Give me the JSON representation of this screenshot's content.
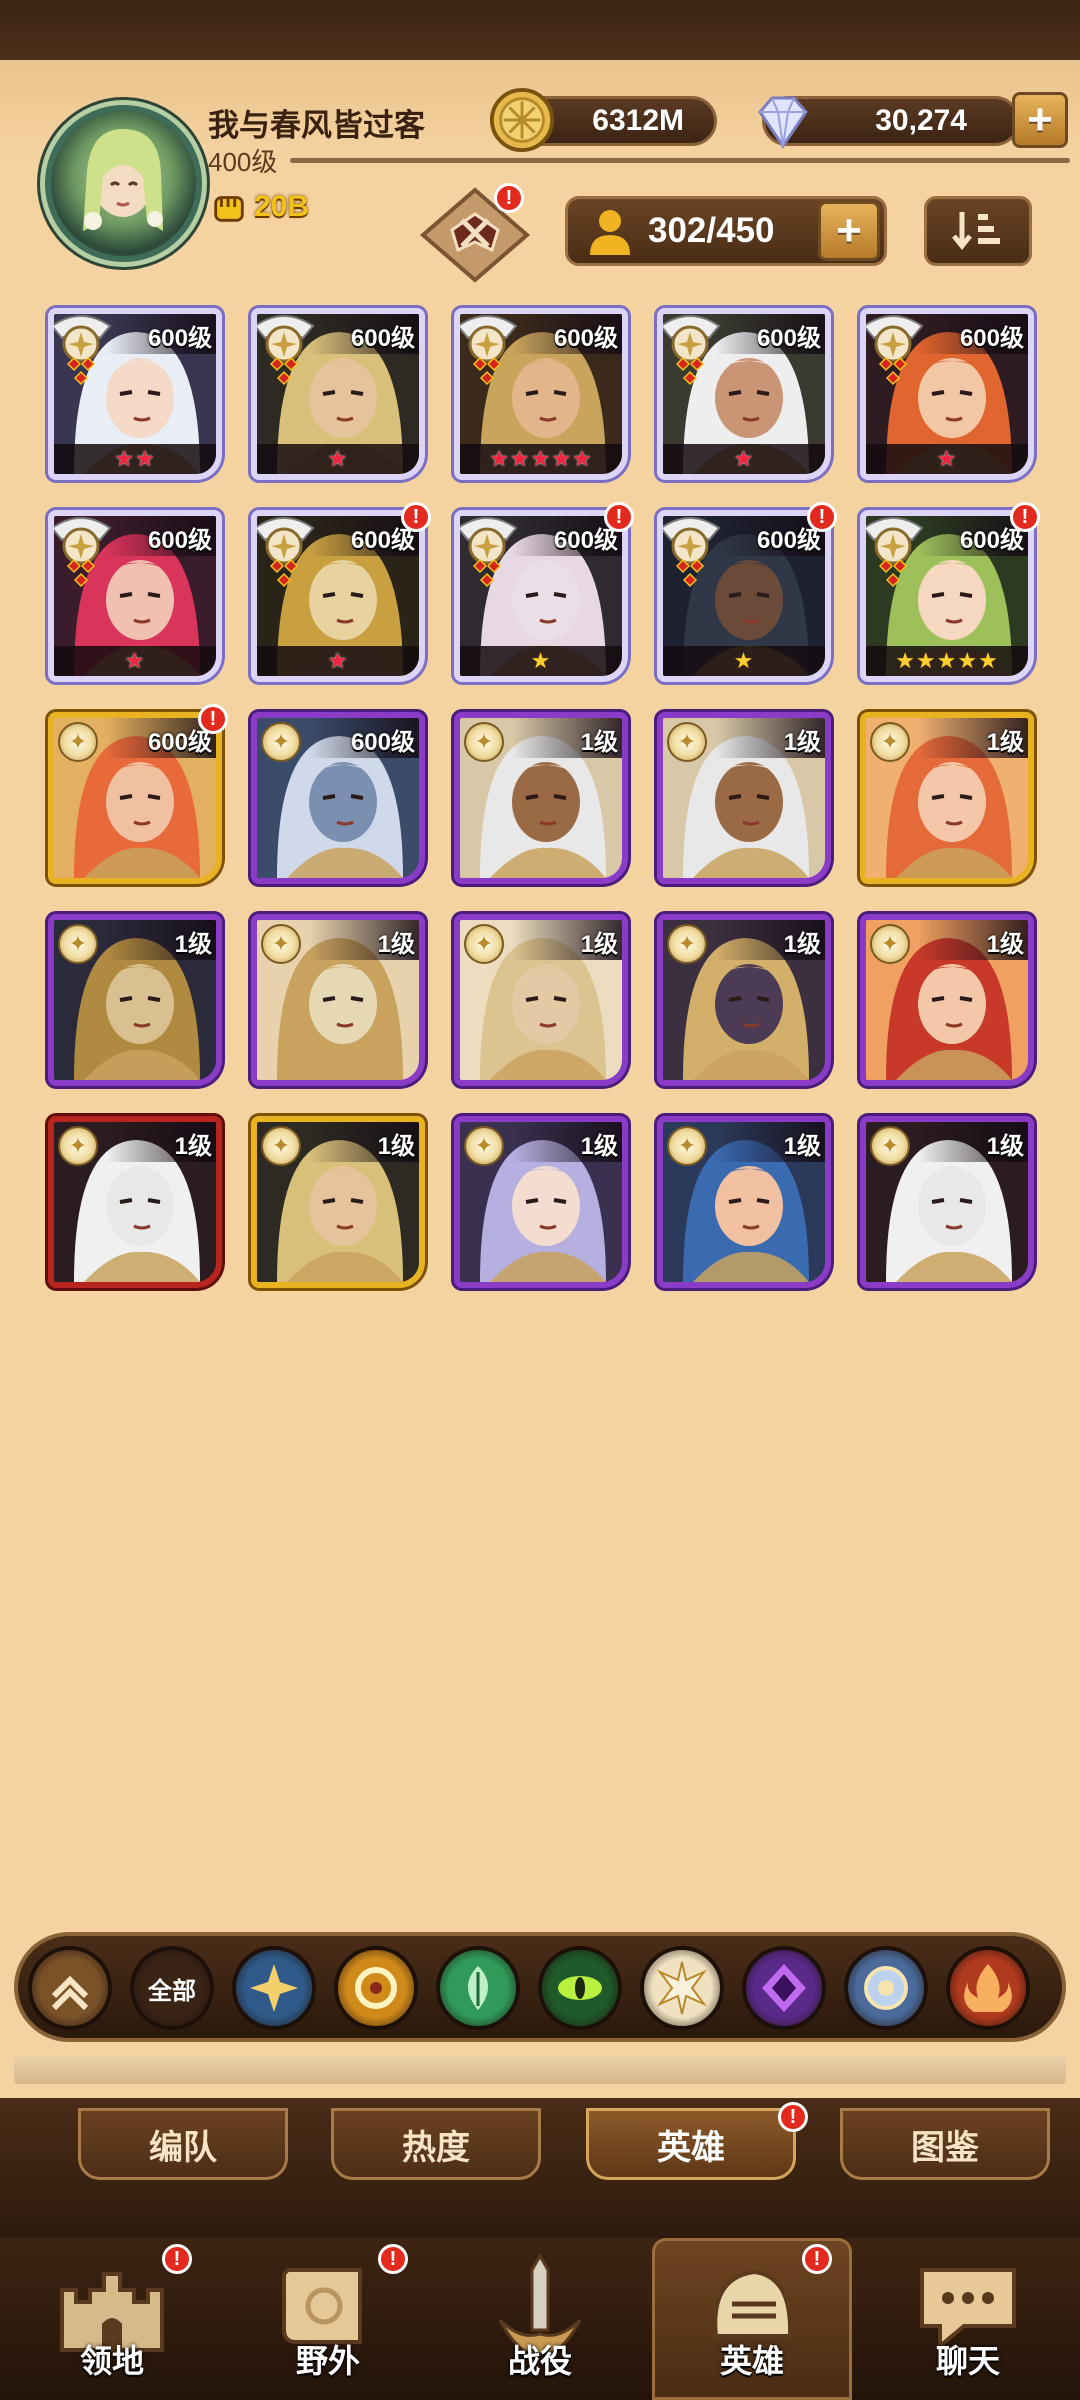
{
  "player": {
    "name": "我与春风皆过客",
    "level": "400级",
    "power": "20B"
  },
  "resources": {
    "gold": "6312M",
    "gems": "30,274",
    "plus": "+"
  },
  "roster": {
    "count": "302/450",
    "plus": "+"
  },
  "badge_mark": "!",
  "heroes": [
    {
      "level": "600级",
      "stars": "★★",
      "star_color": "red",
      "frame": "white",
      "medal": true,
      "skin": "#f3d9c6",
      "hair": "#e9eef6",
      "bg": "#3a3550",
      "alert": false
    },
    {
      "level": "600级",
      "stars": "★",
      "star_color": "red",
      "frame": "white",
      "medal": true,
      "skin": "#e5c39b",
      "hair": "#d9c07a",
      "bg": "#2c2a22",
      "alert": false
    },
    {
      "level": "600级",
      "stars": "★★★★★",
      "star_color": "red",
      "frame": "white",
      "medal": true,
      "skin": "#e3b58a",
      "hair": "#c9a45c",
      "bg": "#3b2a1c",
      "alert": false
    },
    {
      "level": "600级",
      "stars": "★",
      "star_color": "red",
      "frame": "white",
      "medal": true,
      "skin": "#c99575",
      "hair": "#eeeeee",
      "bg": "#3a3a30",
      "alert": false
    },
    {
      "level": "600级",
      "stars": "★",
      "star_color": "red",
      "frame": "white",
      "medal": true,
      "skin": "#f2c7a5",
      "hair": "#e0652e",
      "bg": "#2e1c22",
      "alert": false
    },
    {
      "level": "600级",
      "stars": "★",
      "star_color": "red",
      "frame": "white",
      "medal": true,
      "skin": "#f0c0b0",
      "hair": "#d9345a",
      "bg": "#3a1c2c",
      "alert": false
    },
    {
      "level": "600级",
      "stars": "★",
      "star_color": "red",
      "frame": "white",
      "medal": true,
      "skin": "#e8d2a0",
      "hair": "#c8a040",
      "bg": "#2a2418",
      "alert": true
    },
    {
      "level": "600级",
      "stars": "★",
      "star_color": "gold",
      "frame": "white",
      "medal": true,
      "skin": "#eadfe6",
      "hair": "#e8d8e4",
      "bg": "#2e2a30",
      "alert": true
    },
    {
      "level": "600级",
      "stars": "★",
      "star_color": "gold",
      "frame": "white",
      "medal": true,
      "skin": "#6b4a3a",
      "hair": "#303848",
      "bg": "#1e2230",
      "alert": true
    },
    {
      "level": "600级",
      "stars": "★★★★★",
      "star_color": "gold",
      "frame": "white",
      "medal": true,
      "skin": "#f5d8bf",
      "hair": "#9ec05a",
      "bg": "#2c3a22",
      "alert": true
    },
    {
      "level": "600级",
      "stars": "",
      "star_color": "red",
      "frame": "gold",
      "medal": false,
      "skin": "#f0c0a0",
      "hair": "#e86a3a",
      "bg": "#e2b060",
      "alert": true
    },
    {
      "level": "600级",
      "stars": "",
      "star_color": "red",
      "frame": "purple",
      "medal": false,
      "skin": "#7b8fb0",
      "hair": "#cfd9ea",
      "bg": "#3a4c6a",
      "alert": false
    },
    {
      "level": "1级",
      "stars": "",
      "star_color": "red",
      "frame": "purple",
      "medal": false,
      "skin": "#9a6a44",
      "hair": "#e8e8e8",
      "bg": "#d9c8a8",
      "alert": false
    },
    {
      "level": "1级",
      "stars": "",
      "star_color": "red",
      "frame": "purple",
      "medal": false,
      "skin": "#9a6a44",
      "hair": "#e8e8e8",
      "bg": "#d9c8a8",
      "alert": false
    },
    {
      "level": "1级",
      "stars": "",
      "star_color": "red",
      "frame": "gold",
      "medal": false,
      "skin": "#f3c7a8",
      "hair": "#e46a3a",
      "bg": "#f0b070",
      "alert": false
    },
    {
      "level": "1级",
      "stars": "",
      "star_color": "red",
      "frame": "purple",
      "medal": false,
      "skin": "#d8c090",
      "hair": "#b08a40",
      "bg": "#2a2a3a",
      "alert": false
    },
    {
      "level": "1级",
      "stars": "",
      "star_color": "red",
      "frame": "purple",
      "medal": false,
      "skin": "#e6d7b5",
      "hair": "#c9a25e",
      "bg": "#e8d2ad",
      "alert": false
    },
    {
      "level": "1级",
      "stars": "",
      "star_color": "red",
      "frame": "purple",
      "medal": false,
      "skin": "#e3c9a4",
      "hair": "#dcc490",
      "bg": "#ecdcc0",
      "alert": false
    },
    {
      "level": "1级",
      "stars": "",
      "star_color": "red",
      "frame": "purple",
      "medal": false,
      "skin": "#4b3b54",
      "hair": "#d2b06a",
      "bg": "#3c3040",
      "alert": false
    },
    {
      "level": "1级",
      "stars": "",
      "star_color": "red",
      "frame": "purple",
      "medal": false,
      "skin": "#f3c7a8",
      "hair": "#c8392a",
      "bg": "#f0a060",
      "alert": false
    },
    {
      "level": "1级",
      "stars": "",
      "star_color": "red",
      "frame": "red",
      "medal": false,
      "skin": "#e8e8e8",
      "hair": "#f0f0f0",
      "bg": "#2a1c20",
      "alert": false
    },
    {
      "level": "1级",
      "stars": "",
      "star_color": "red",
      "frame": "gold",
      "medal": false,
      "skin": "#e5c39b",
      "hair": "#d9c07a",
      "bg": "#2c2a22",
      "alert": false
    },
    {
      "level": "1级",
      "stars": "",
      "star_color": "red",
      "frame": "purple",
      "medal": false,
      "skin": "#f4dcd0",
      "hair": "#b6b0e0",
      "bg": "#3a3050",
      "alert": false
    },
    {
      "level": "1级",
      "stars": "",
      "star_color": "red",
      "frame": "purple",
      "medal": false,
      "skin": "#f0c0a0",
      "hair": "#3a6ab0",
      "bg": "#2b3a5a",
      "alert": false
    },
    {
      "level": "1级",
      "stars": "",
      "star_color": "red",
      "frame": "purple",
      "medal": false,
      "skin": "#e8e8e8",
      "hair": "#f0f0f0",
      "bg": "#2a1c20",
      "alert": false
    }
  ],
  "filters": [
    {
      "name": "collapse",
      "label": "",
      "color": "#7a5228",
      "icon": "chevron-up"
    },
    {
      "name": "all",
      "label": "全部",
      "color": "#3a2416",
      "icon": "text"
    },
    {
      "name": "lightbearer",
      "label": "",
      "color": "#2f5a8a",
      "icon": "star4"
    },
    {
      "name": "mauler",
      "label": "",
      "color": "#d08a1a",
      "icon": "ring"
    },
    {
      "name": "wilder",
      "label": "",
      "color": "#2f9a5a",
      "icon": "leaf"
    },
    {
      "name": "graveborn",
      "label": "",
      "color": "#1f5a2a",
      "icon": "eye"
    },
    {
      "name": "celestial",
      "label": "",
      "color": "#f0e2c0",
      "icon": "star8"
    },
    {
      "name": "hypogean",
      "label": "",
      "color": "#5a2a8a",
      "icon": "diamond"
    },
    {
      "name": "dimensional",
      "label": "",
      "color": "#4a6a9a",
      "icon": "shield"
    },
    {
      "name": "dragon",
      "label": "",
      "color": "#b03a1e",
      "icon": "flame"
    }
  ],
  "subtabs": [
    {
      "label": "编队",
      "active": false,
      "alert": false
    },
    {
      "label": "热度",
      "active": false,
      "alert": false
    },
    {
      "label": "英雄",
      "active": true,
      "alert": true
    },
    {
      "label": "图鉴",
      "active": false,
      "alert": false
    }
  ],
  "nav": [
    {
      "label": "领地",
      "active": false,
      "alert": true,
      "icon": "castle"
    },
    {
      "label": "野外",
      "active": false,
      "alert": true,
      "icon": "scroll"
    },
    {
      "label": "战役",
      "active": false,
      "alert": false,
      "icon": "sword"
    },
    {
      "label": "英雄",
      "active": true,
      "alert": true,
      "icon": "helmet"
    },
    {
      "label": "聊天",
      "active": false,
      "alert": false,
      "icon": "chat"
    }
  ]
}
